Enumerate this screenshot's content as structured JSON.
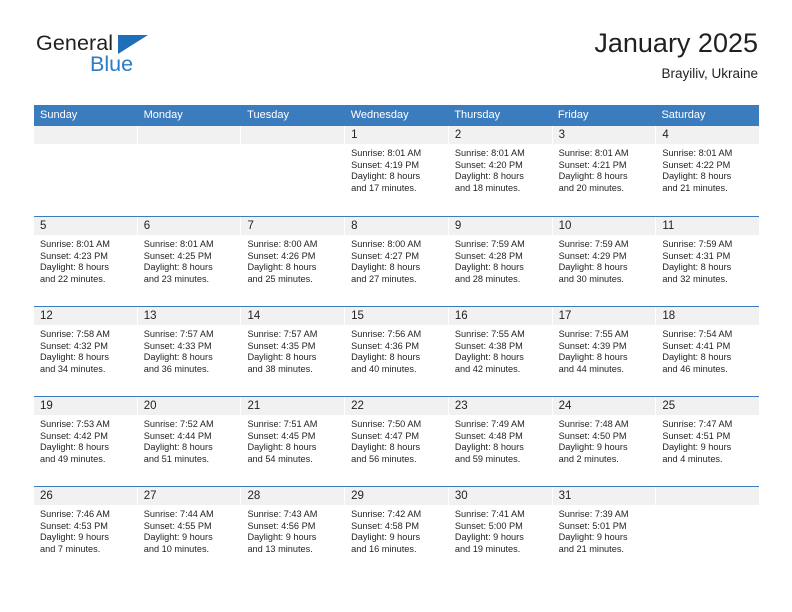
{
  "brand": {
    "name_dark": "General",
    "name_blue": "Blue",
    "triangle_icon": "triangle-icon",
    "accent_color": "#2a7cc7",
    "header_blue": "#3b7cbe"
  },
  "header": {
    "title": "January 2025",
    "subtitle": "Brayiliv, Ukraine"
  },
  "calendar": {
    "weekdays": [
      "Sunday",
      "Monday",
      "Tuesday",
      "Wednesday",
      "Thursday",
      "Friday",
      "Saturday"
    ],
    "weeks": [
      [
        {
          "day": "",
          "sunrise": "",
          "sunset": "",
          "daylight1": "",
          "daylight2": "",
          "empty": true
        },
        {
          "day": "",
          "sunrise": "",
          "sunset": "",
          "daylight1": "",
          "daylight2": "",
          "empty": true
        },
        {
          "day": "",
          "sunrise": "",
          "sunset": "",
          "daylight1": "",
          "daylight2": "",
          "empty": true
        },
        {
          "day": "1",
          "sunrise": "Sunrise: 8:01 AM",
          "sunset": "Sunset: 4:19 PM",
          "daylight1": "Daylight: 8 hours",
          "daylight2": "and 17 minutes."
        },
        {
          "day": "2",
          "sunrise": "Sunrise: 8:01 AM",
          "sunset": "Sunset: 4:20 PM",
          "daylight1": "Daylight: 8 hours",
          "daylight2": "and 18 minutes."
        },
        {
          "day": "3",
          "sunrise": "Sunrise: 8:01 AM",
          "sunset": "Sunset: 4:21 PM",
          "daylight1": "Daylight: 8 hours",
          "daylight2": "and 20 minutes."
        },
        {
          "day": "4",
          "sunrise": "Sunrise: 8:01 AM",
          "sunset": "Sunset: 4:22 PM",
          "daylight1": "Daylight: 8 hours",
          "daylight2": "and 21 minutes."
        }
      ],
      [
        {
          "day": "5",
          "sunrise": "Sunrise: 8:01 AM",
          "sunset": "Sunset: 4:23 PM",
          "daylight1": "Daylight: 8 hours",
          "daylight2": "and 22 minutes."
        },
        {
          "day": "6",
          "sunrise": "Sunrise: 8:01 AM",
          "sunset": "Sunset: 4:25 PM",
          "daylight1": "Daylight: 8 hours",
          "daylight2": "and 23 minutes."
        },
        {
          "day": "7",
          "sunrise": "Sunrise: 8:00 AM",
          "sunset": "Sunset: 4:26 PM",
          "daylight1": "Daylight: 8 hours",
          "daylight2": "and 25 minutes."
        },
        {
          "day": "8",
          "sunrise": "Sunrise: 8:00 AM",
          "sunset": "Sunset: 4:27 PM",
          "daylight1": "Daylight: 8 hours",
          "daylight2": "and 27 minutes."
        },
        {
          "day": "9",
          "sunrise": "Sunrise: 7:59 AM",
          "sunset": "Sunset: 4:28 PM",
          "daylight1": "Daylight: 8 hours",
          "daylight2": "and 28 minutes."
        },
        {
          "day": "10",
          "sunrise": "Sunrise: 7:59 AM",
          "sunset": "Sunset: 4:29 PM",
          "daylight1": "Daylight: 8 hours",
          "daylight2": "and 30 minutes."
        },
        {
          "day": "11",
          "sunrise": "Sunrise: 7:59 AM",
          "sunset": "Sunset: 4:31 PM",
          "daylight1": "Daylight: 8 hours",
          "daylight2": "and 32 minutes."
        }
      ],
      [
        {
          "day": "12",
          "sunrise": "Sunrise: 7:58 AM",
          "sunset": "Sunset: 4:32 PM",
          "daylight1": "Daylight: 8 hours",
          "daylight2": "and 34 minutes."
        },
        {
          "day": "13",
          "sunrise": "Sunrise: 7:57 AM",
          "sunset": "Sunset: 4:33 PM",
          "daylight1": "Daylight: 8 hours",
          "daylight2": "and 36 minutes."
        },
        {
          "day": "14",
          "sunrise": "Sunrise: 7:57 AM",
          "sunset": "Sunset: 4:35 PM",
          "daylight1": "Daylight: 8 hours",
          "daylight2": "and 38 minutes."
        },
        {
          "day": "15",
          "sunrise": "Sunrise: 7:56 AM",
          "sunset": "Sunset: 4:36 PM",
          "daylight1": "Daylight: 8 hours",
          "daylight2": "and 40 minutes."
        },
        {
          "day": "16",
          "sunrise": "Sunrise: 7:55 AM",
          "sunset": "Sunset: 4:38 PM",
          "daylight1": "Daylight: 8 hours",
          "daylight2": "and 42 minutes."
        },
        {
          "day": "17",
          "sunrise": "Sunrise: 7:55 AM",
          "sunset": "Sunset: 4:39 PM",
          "daylight1": "Daylight: 8 hours",
          "daylight2": "and 44 minutes."
        },
        {
          "day": "18",
          "sunrise": "Sunrise: 7:54 AM",
          "sunset": "Sunset: 4:41 PM",
          "daylight1": "Daylight: 8 hours",
          "daylight2": "and 46 minutes."
        }
      ],
      [
        {
          "day": "19",
          "sunrise": "Sunrise: 7:53 AM",
          "sunset": "Sunset: 4:42 PM",
          "daylight1": "Daylight: 8 hours",
          "daylight2": "and 49 minutes."
        },
        {
          "day": "20",
          "sunrise": "Sunrise: 7:52 AM",
          "sunset": "Sunset: 4:44 PM",
          "daylight1": "Daylight: 8 hours",
          "daylight2": "and 51 minutes."
        },
        {
          "day": "21",
          "sunrise": "Sunrise: 7:51 AM",
          "sunset": "Sunset: 4:45 PM",
          "daylight1": "Daylight: 8 hours",
          "daylight2": "and 54 minutes."
        },
        {
          "day": "22",
          "sunrise": "Sunrise: 7:50 AM",
          "sunset": "Sunset: 4:47 PM",
          "daylight1": "Daylight: 8 hours",
          "daylight2": "and 56 minutes."
        },
        {
          "day": "23",
          "sunrise": "Sunrise: 7:49 AM",
          "sunset": "Sunset: 4:48 PM",
          "daylight1": "Daylight: 8 hours",
          "daylight2": "and 59 minutes."
        },
        {
          "day": "24",
          "sunrise": "Sunrise: 7:48 AM",
          "sunset": "Sunset: 4:50 PM",
          "daylight1": "Daylight: 9 hours",
          "daylight2": "and 2 minutes."
        },
        {
          "day": "25",
          "sunrise": "Sunrise: 7:47 AM",
          "sunset": "Sunset: 4:51 PM",
          "daylight1": "Daylight: 9 hours",
          "daylight2": "and 4 minutes."
        }
      ],
      [
        {
          "day": "26",
          "sunrise": "Sunrise: 7:46 AM",
          "sunset": "Sunset: 4:53 PM",
          "daylight1": "Daylight: 9 hours",
          "daylight2": "and 7 minutes."
        },
        {
          "day": "27",
          "sunrise": "Sunrise: 7:44 AM",
          "sunset": "Sunset: 4:55 PM",
          "daylight1": "Daylight: 9 hours",
          "daylight2": "and 10 minutes."
        },
        {
          "day": "28",
          "sunrise": "Sunrise: 7:43 AM",
          "sunset": "Sunset: 4:56 PM",
          "daylight1": "Daylight: 9 hours",
          "daylight2": "and 13 minutes."
        },
        {
          "day": "29",
          "sunrise": "Sunrise: 7:42 AM",
          "sunset": "Sunset: 4:58 PM",
          "daylight1": "Daylight: 9 hours",
          "daylight2": "and 16 minutes."
        },
        {
          "day": "30",
          "sunrise": "Sunrise: 7:41 AM",
          "sunset": "Sunset: 5:00 PM",
          "daylight1": "Daylight: 9 hours",
          "daylight2": "and 19 minutes."
        },
        {
          "day": "31",
          "sunrise": "Sunrise: 7:39 AM",
          "sunset": "Sunset: 5:01 PM",
          "daylight1": "Daylight: 9 hours",
          "daylight2": "and 21 minutes."
        },
        {
          "day": "",
          "sunrise": "",
          "sunset": "",
          "daylight1": "",
          "daylight2": "",
          "empty": true
        }
      ]
    ]
  }
}
